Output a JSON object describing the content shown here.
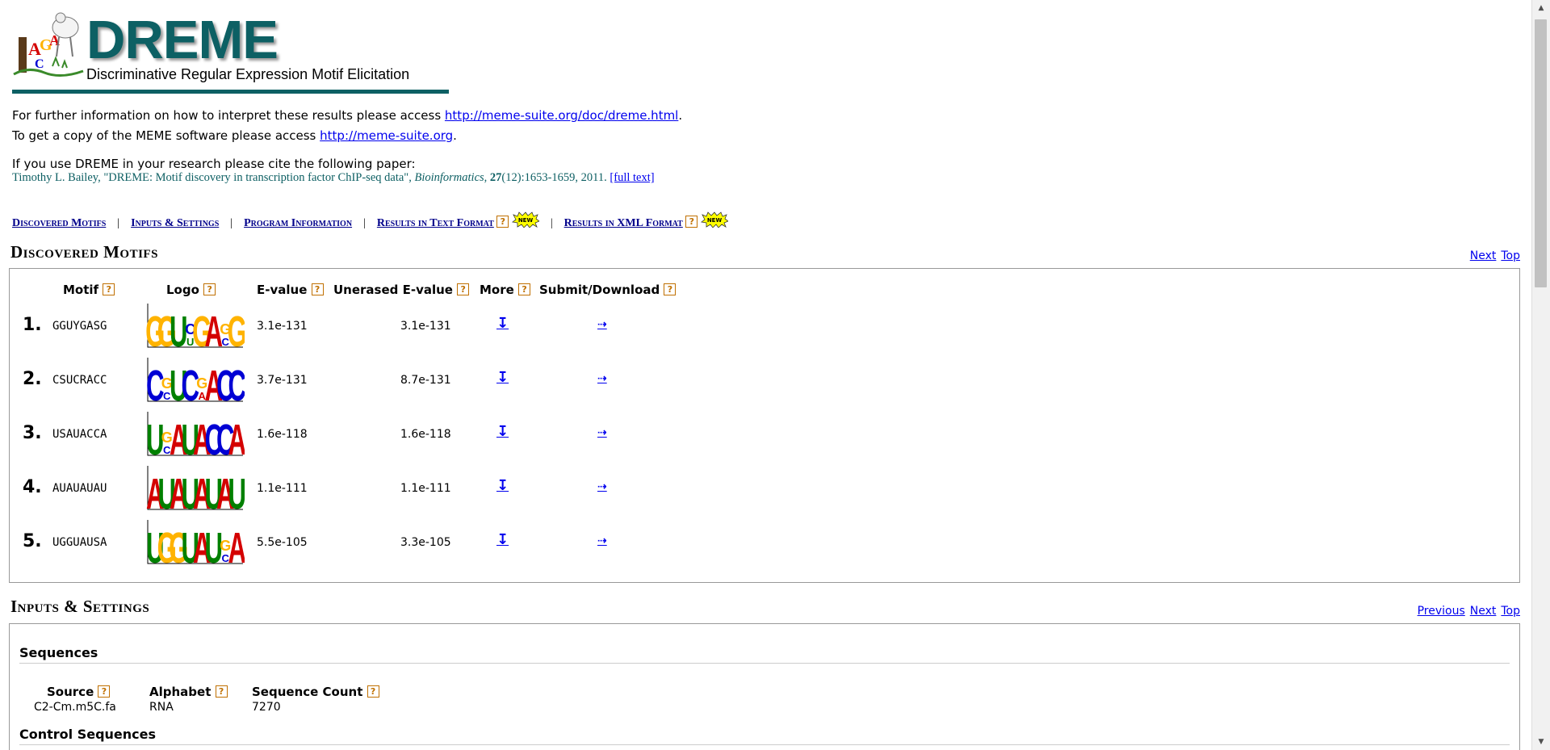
{
  "header": {
    "title": "DREME",
    "subtitle": "Discriminative Regular Expression Motif Elicitation"
  },
  "intro": {
    "line1_prefix": "For further information on how to interpret these results please access ",
    "line1_link": "http://meme-suite.org/doc/dreme.html",
    "line1_suffix": ".",
    "line2_prefix": "To get a copy of the MEME software please access ",
    "line2_link": "http://meme-suite.org",
    "line2_suffix": ".",
    "cite_intro": "If you use DREME in your research please cite the following paper:",
    "cite_author": "Timothy L. Bailey, \"DREME: Motif discovery in transcription factor ChIP-seq data\", ",
    "cite_journal": "Bioinformatics",
    "cite_sep": ", ",
    "cite_vol": "27",
    "cite_rest": "(12):1653-1659, 2011. ",
    "cite_link": "[full text]"
  },
  "nav": {
    "discovered": "Discovered Motifs",
    "inputs": "Inputs & Settings",
    "program": "Program Information",
    "text": "Results in Text Format",
    "xml": "Results in XML Format",
    "sep": "|",
    "new_label": "NEW"
  },
  "help_glyph": "?",
  "discovered": {
    "title": "Discovered Motifs",
    "next": "Next",
    "top": "Top",
    "headers": {
      "motif": "Motif",
      "logo": "Logo",
      "evalue": "E-value",
      "unerased": "Unerased E-value",
      "more": "More",
      "submit": "Submit/Download"
    },
    "rows": [
      {
        "num": "1.",
        "motif": "GGUYGASG",
        "evalue": "3.1e-131",
        "unerased": "3.1e-131",
        "more": "↧",
        "submit": "⇢"
      },
      {
        "num": "2.",
        "motif": "CSUCRACC",
        "evalue": "3.7e-131",
        "unerased": "8.7e-131",
        "more": "↧",
        "submit": "⇢"
      },
      {
        "num": "3.",
        "motif": "USAUACCA",
        "evalue": "1.6e-118",
        "unerased": "1.6e-118",
        "more": "↧",
        "submit": "⇢"
      },
      {
        "num": "4.",
        "motif": "AUAUAUAU",
        "evalue": "1.1e-111",
        "unerased": "1.1e-111",
        "more": "↧",
        "submit": "⇢"
      },
      {
        "num": "5.",
        "motif": "UGGUAUSA",
        "evalue": "5.5e-105",
        "unerased": "3.3e-105",
        "more": "↧",
        "submit": "⇢"
      }
    ]
  },
  "inputs": {
    "title": "Inputs & Settings",
    "previous": "Previous",
    "next": "Next",
    "top": "Top",
    "sequences_title": "Sequences",
    "headers": {
      "source": "Source",
      "alphabet": "Alphabet",
      "count": "Sequence Count"
    },
    "source": "C2-Cm.m5C.fa",
    "alphabet": "RNA",
    "count": "7270",
    "control_title": "Control Sequences"
  },
  "colors": {
    "brand": "#0d6064",
    "A": "#d40000",
    "C": "#0000d4",
    "G": "#ffb300",
    "U": "#008000"
  }
}
